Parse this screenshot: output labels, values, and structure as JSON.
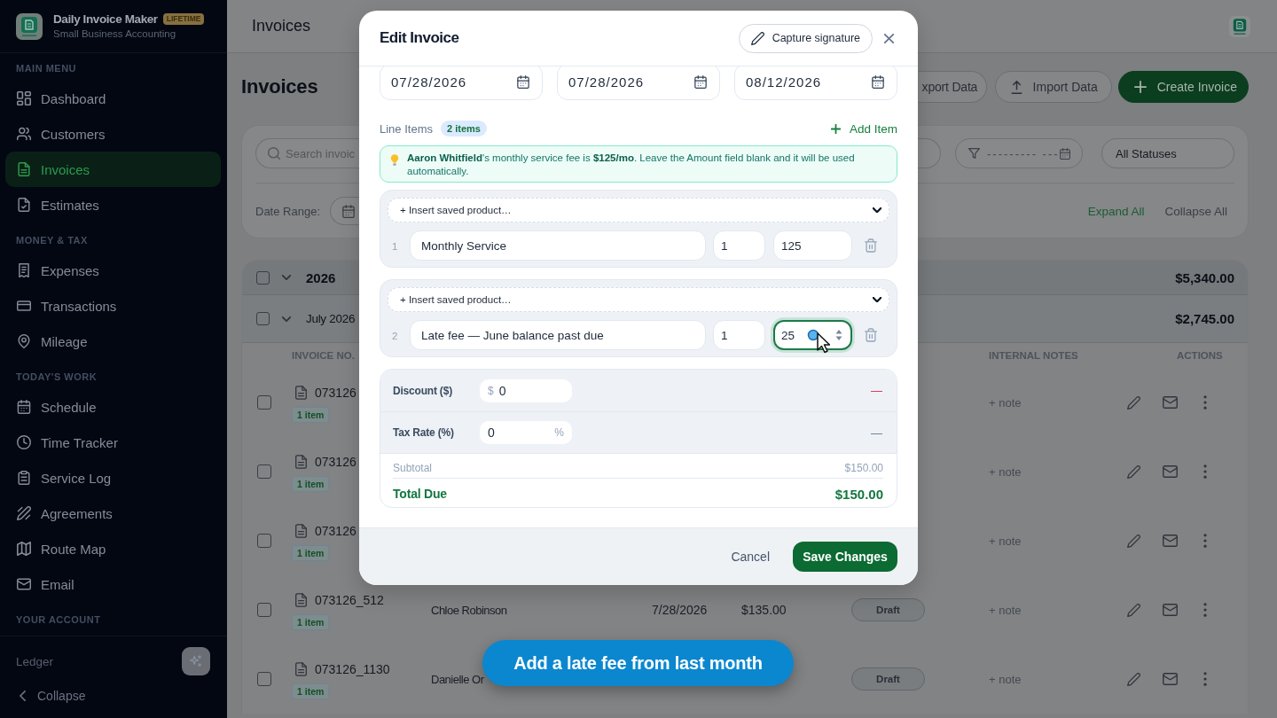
{
  "sidebar": {
    "app": {
      "name": "Daily Invoice Maker",
      "badge": "LIFETIME",
      "subtitle": "Small Business Accounting"
    },
    "sections": [
      {
        "title": "MAIN MENU",
        "items": [
          {
            "label": "Dashboard",
            "selected": false
          },
          {
            "label": "Customers",
            "selected": false
          },
          {
            "label": "Invoices",
            "selected": true
          },
          {
            "label": "Estimates",
            "selected": false
          }
        ]
      },
      {
        "title": "MONEY & TAX",
        "items": [
          {
            "label": "Expenses",
            "selected": false
          },
          {
            "label": "Transactions",
            "selected": false
          },
          {
            "label": "Mileage",
            "selected": false
          }
        ]
      },
      {
        "title": "TODAY'S WORK",
        "items": [
          {
            "label": "Schedule",
            "selected": false
          },
          {
            "label": "Time Tracker",
            "selected": false
          },
          {
            "label": "Service Log",
            "selected": false
          },
          {
            "label": "Agreements",
            "selected": false
          },
          {
            "label": "Route Map",
            "selected": false
          },
          {
            "label": "Email",
            "selected": false
          }
        ]
      },
      {
        "title": "YOUR ACCOUNT"
      }
    ],
    "footer": {
      "workspace": "Ledger",
      "collapse": "Collapse"
    }
  },
  "header": {
    "title": "Invoices"
  },
  "page": {
    "title": "Invoices",
    "actions": [
      {
        "kind": "export",
        "label": "xport Data"
      },
      {
        "kind": "import",
        "label": "Import Data"
      },
      {
        "kind": "create",
        "label": "Create Invoice"
      }
    ]
  },
  "filters": {
    "search": {
      "placeholder": "Search invoic"
    },
    "date_filter": {
      "placeholder": "--------- ---"
    },
    "status": {
      "value": "All Statuses"
    },
    "date_range_label": "Date Range:",
    "expand_all": "Expand All",
    "collapse_all": "Collapse All"
  },
  "table": {
    "year_group": {
      "label": "2026",
      "total": "$5,340.00",
      "checked": false,
      "expanded": true
    },
    "month_group": {
      "label": "July 2026",
      "total": "$2,745.00",
      "checked": false,
      "expanded": true
    },
    "columns": [
      {
        "label": "INVOICE NO."
      },
      {
        "label": "INTERNAL NOTES"
      },
      {
        "label": "ACTIONS"
      }
    ],
    "rows": [
      {
        "checked": false,
        "number": "073126",
        "items": "1 item",
        "note": "+ note"
      },
      {
        "checked": false,
        "number": "073126",
        "items": "1 item",
        "note": "+ note"
      },
      {
        "checked": false,
        "number": "073126",
        "items": "1 item",
        "note": "+ note"
      },
      {
        "checked": false,
        "number": "073126_512",
        "items": "1 item",
        "customer": "Chloe Robinson",
        "date": "7/28/2026",
        "amount": "$135.00",
        "status": "Draft",
        "note": "+ note"
      },
      {
        "checked": false,
        "number": "073126_1130",
        "items": "1 item",
        "customer": "Danielle Or",
        "status": "Draft",
        "note": "+ note"
      }
    ]
  },
  "modal": {
    "title": "Edit Invoice",
    "signature_button": "Capture signature",
    "dates": [
      {
        "value": "07/28/2026"
      },
      {
        "value": "07/28/2026"
      },
      {
        "value": "08/12/2026"
      }
    ],
    "line_items_label": "Line Items",
    "item_count": "2 items",
    "add_item": "Add Item",
    "notice": "**Aaron Whitfield**'s monthly service fee is **$125/mo**. Leave the Amount field blank and it will be used automatically.",
    "line_items": [
      {
        "number": "1",
        "product_select": "+ Insert saved product…",
        "description": "Monthly Service",
        "quantity": "1",
        "amount": "125",
        "focused": false
      },
      {
        "number": "2",
        "product_select": "+ Insert saved product…",
        "description": "Late fee — June balance past due",
        "quantity": "1",
        "amount": "25",
        "focused": true
      }
    ],
    "adjustments": [
      {
        "kind": "discount",
        "label": "Discount ($)",
        "unit": "$",
        "value": "0",
        "result": "—"
      },
      {
        "kind": "tax",
        "label": "Tax Rate (%)",
        "unit": "%",
        "value": "0",
        "result": "—"
      }
    ],
    "subtotal": {
      "label": "Subtotal",
      "value": "$150.00"
    },
    "total": {
      "label": "Total Due",
      "value": "$150.00"
    },
    "cancel": "Cancel",
    "save": "Save Changes"
  },
  "caption": "Add a late fee from last month"
}
